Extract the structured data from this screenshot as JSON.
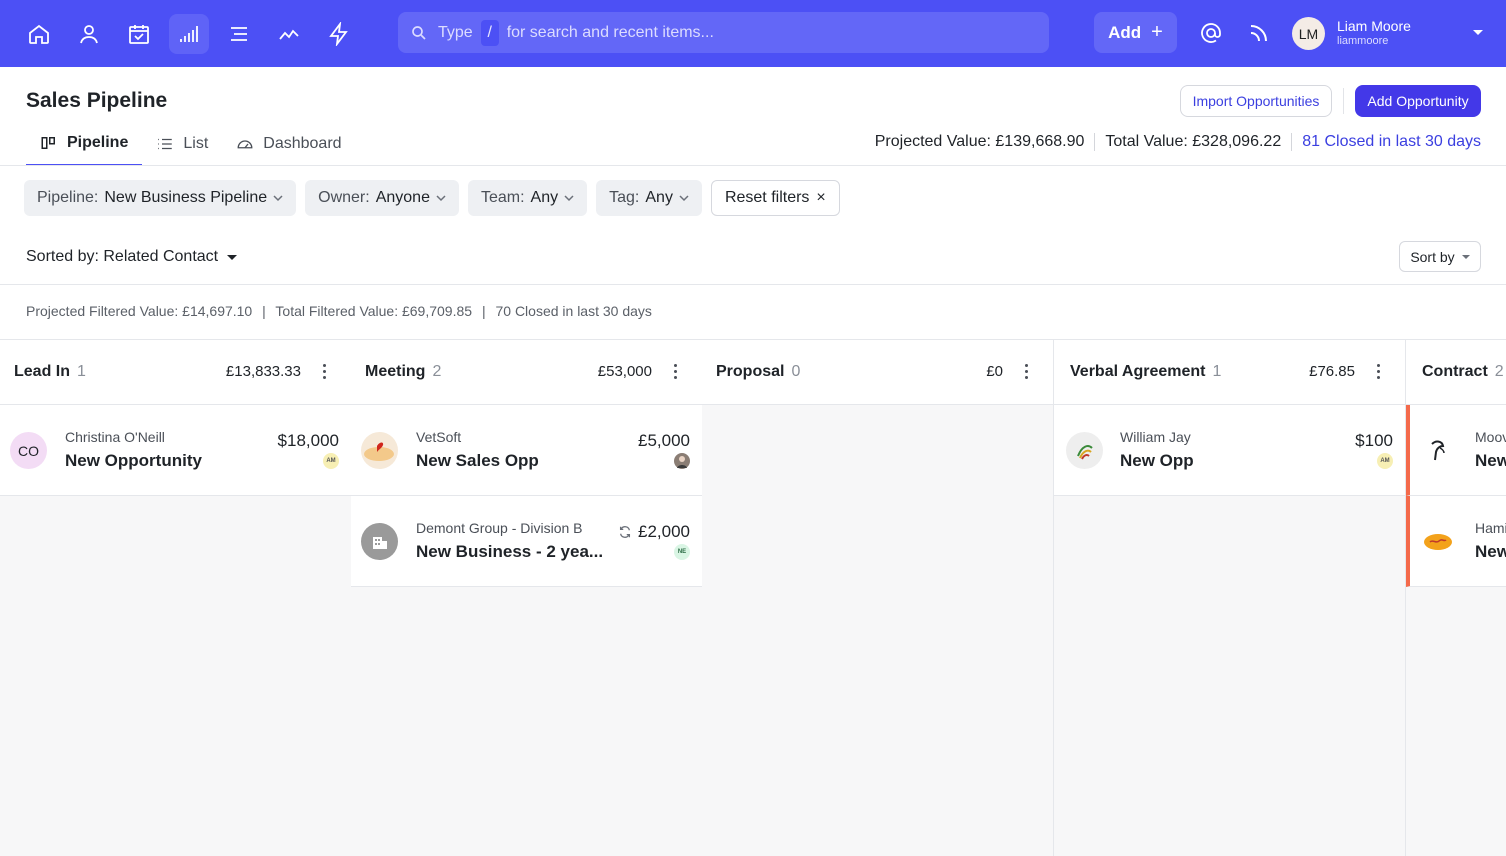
{
  "colors": {
    "brand": "#4c50f5",
    "primary_button": "#4338e8",
    "link": "#3b3fe0",
    "contract_flag": "#f46a4b"
  },
  "nav": {
    "icons": [
      "home-icon",
      "person-icon",
      "calendar-icon",
      "pipeline-icon",
      "list-icon",
      "trend-icon",
      "lightning-icon"
    ],
    "active": "pipeline-icon"
  },
  "search": {
    "type_label": "Type",
    "slash": "/",
    "hint": "for search and recent items..."
  },
  "header_actions": {
    "add_label": "Add",
    "add_plus": "+"
  },
  "user": {
    "initials": "LM",
    "name": "Liam Moore",
    "handle": "liammoore"
  },
  "page": {
    "title": "Sales Pipeline",
    "import_label": "Import Opportunities",
    "add_opportunity_label": "Add Opportunity"
  },
  "tabs": [
    {
      "label": "Pipeline",
      "icon": "columns-icon",
      "active": true
    },
    {
      "label": "List",
      "icon": "list-icon"
    },
    {
      "label": "Dashboard",
      "icon": "gauge-icon"
    }
  ],
  "summary": {
    "projected": "Projected Value: £139,668.90",
    "total": "Total Value: £328,096.22",
    "closed": "81 Closed in last 30 days"
  },
  "filters": [
    {
      "label": "Pipeline:",
      "value": "New Business Pipeline"
    },
    {
      "label": "Owner:",
      "value": "Anyone"
    },
    {
      "label": "Team:",
      "value": "Any"
    },
    {
      "label": "Tag:",
      "value": "Any"
    }
  ],
  "reset_label": "Reset filters",
  "reset_x": "×",
  "sorted_label": "Sorted by: Related Contact",
  "sortby_label": "Sort by",
  "filtered_summary": {
    "projected": "Projected Filtered Value: £14,697.10",
    "total": "Total Filtered Value: £69,709.85",
    "closed": "70 Closed in last 30 days",
    "sep": "|"
  },
  "columns": [
    {
      "name": "Lead In",
      "count": "1",
      "value": "£13,833.33",
      "cards": [
        {
          "contact": "Christina O'Neill",
          "title": "New Opportunity",
          "amount": "$18,000",
          "avatar": "CO",
          "owner": "AM"
        }
      ]
    },
    {
      "name": "Meeting",
      "count": "2",
      "value": "£53,000",
      "cards": [
        {
          "contact": "VetSoft",
          "title": "New Sales Opp",
          "amount": "£5,000",
          "avatar_icon": "vetsoft-logo-icon",
          "owner_icon": "owner-photo-icon"
        },
        {
          "contact": "Demont Group - Division B",
          "title": "New Business - 2 yea...",
          "amount": "£2,000",
          "avatar_icon": "building-icon",
          "owner": "NE",
          "recurring_icon": "refresh-icon"
        }
      ]
    },
    {
      "name": "Proposal",
      "count": "0",
      "value": "£0",
      "cards": []
    },
    {
      "name": "Verbal Agreement",
      "count": "1",
      "value": "£76.85",
      "cards": [
        {
          "contact": "William Jay",
          "title": "New Opp",
          "amount": "$100",
          "avatar_icon": "company-logo-icon",
          "owner": "AM"
        }
      ]
    },
    {
      "name": "Contract",
      "count": "2",
      "value": "",
      "cards": [
        {
          "contact": "Moov",
          "title": "New",
          "avatar_icon": "company-logo-icon"
        },
        {
          "contact": "Hamil",
          "title": "New",
          "avatar_icon": "company-logo-icon"
        }
      ]
    }
  ]
}
